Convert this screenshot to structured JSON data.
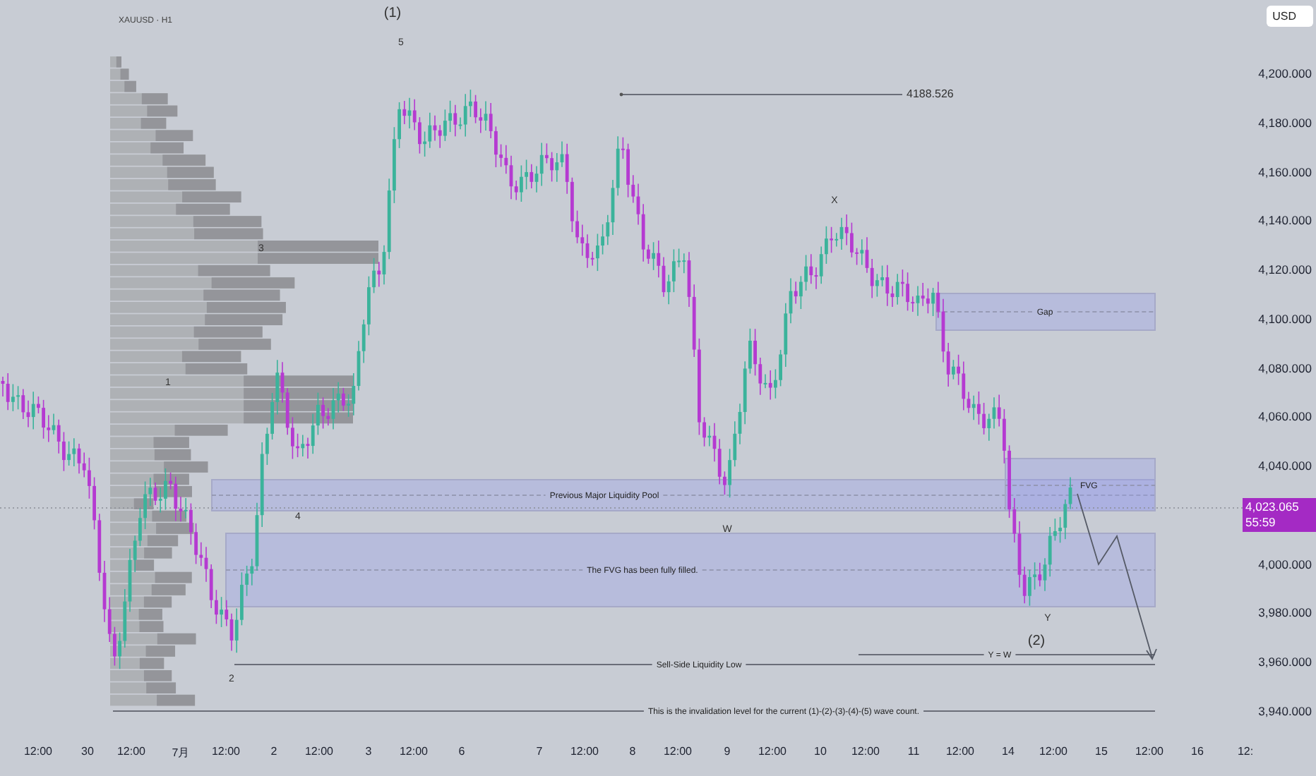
{
  "chart": {
    "symbol": "XAUUSD · H1",
    "currency": "USD",
    "price_axis": [
      "4,200.000",
      "4,180.000",
      "4,160.000",
      "4,140.000",
      "4,120.000",
      "4,100.000",
      "4,080.000",
      "4,060.000",
      "4,040.000",
      "4,000.000",
      "3,980.000",
      "3,960.000",
      "3,940.000"
    ],
    "current_price": "4,023.065",
    "countdown": "55:59",
    "time_axis": [
      "12:00",
      "30",
      "12:00",
      "7月",
      "12:00",
      "2",
      "12:00",
      "3",
      "12:00",
      "6",
      "7",
      "12:00",
      "8",
      "12:00",
      "9",
      "12:00",
      "10",
      "12:00",
      "11",
      "12:00",
      "14",
      "12:00",
      "15",
      "12:00",
      "16",
      "12:"
    ],
    "wave_labels": [
      "(1)",
      "5",
      "3",
      "1",
      "4",
      "2",
      "W",
      "X",
      "Y",
      "(2)"
    ],
    "zones": [
      {
        "label": "Gap"
      },
      {
        "label": "Previous Major Liquidity Pool"
      },
      {
        "label": "The FVG has been fully filled."
      },
      {
        "label": "FVG"
      }
    ],
    "levels": [
      {
        "label": "4188.526"
      },
      {
        "label": "Sell-Side Liquidity Low"
      },
      {
        "label": "This is the invalidation level for the current (1)-(2)-(3)-(4)-(5) wave count."
      },
      {
        "label": "Y = W"
      }
    ]
  }
}
